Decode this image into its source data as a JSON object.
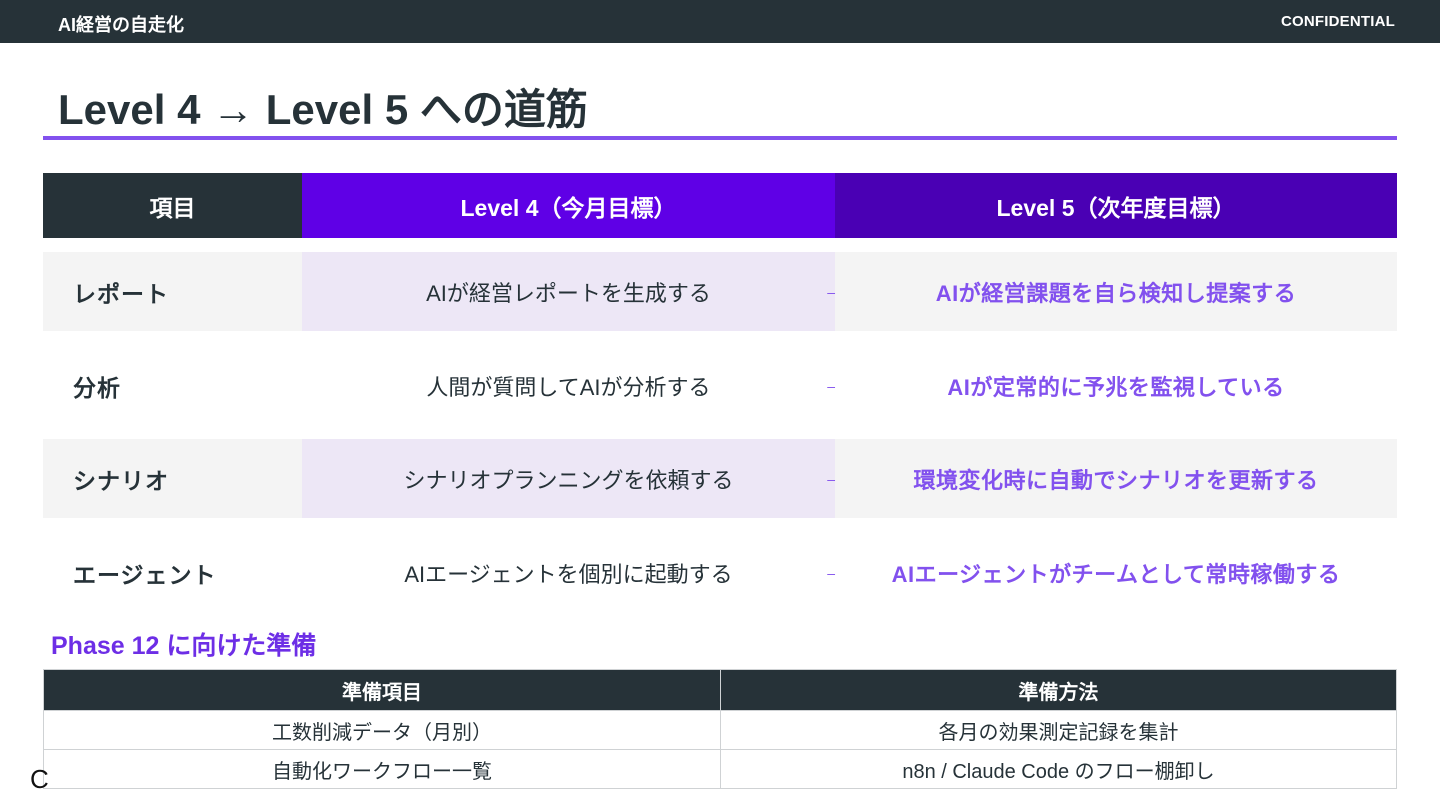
{
  "header": {
    "brand": "AI経営の自走化",
    "confidential": "CONFIDENTIAL"
  },
  "title": "Level 4 → Level 5 への道筋",
  "comparison": {
    "columns": [
      "項目",
      "Level 4（今月目標）",
      "Level 5（次年度目標）"
    ],
    "arrow": "–",
    "rows": [
      {
        "item": "レポート",
        "level4": "AIが経営レポートを生成する",
        "level5": "AIが経営課題を自ら検知し提案する"
      },
      {
        "item": "分析",
        "level4": "人間が質問してAIが分析する",
        "level5": "AIが定常的に予兆を監視している"
      },
      {
        "item": "シナリオ",
        "level4": "シナリオプランニングを依頼する",
        "level5": "環境変化時に自動でシナリオを更新する"
      },
      {
        "item": "エージェント",
        "level4": "AIエージェントを個別に起動する",
        "level5": "AIエージェントがチームとして常時稼働する"
      }
    ]
  },
  "prep": {
    "heading": "Phase 12 に向けた準備",
    "columns": [
      "準備項目",
      "準備方法"
    ],
    "rows": [
      {
        "item": "工数削減データ（月別）",
        "method": "各月の効果測定記録を集計"
      },
      {
        "item": "自動化ワークフロー一覧",
        "method": "n8n / Claude Code のフロー棚卸し"
      }
    ]
  },
  "footer": {
    "cut_text": "C"
  }
}
